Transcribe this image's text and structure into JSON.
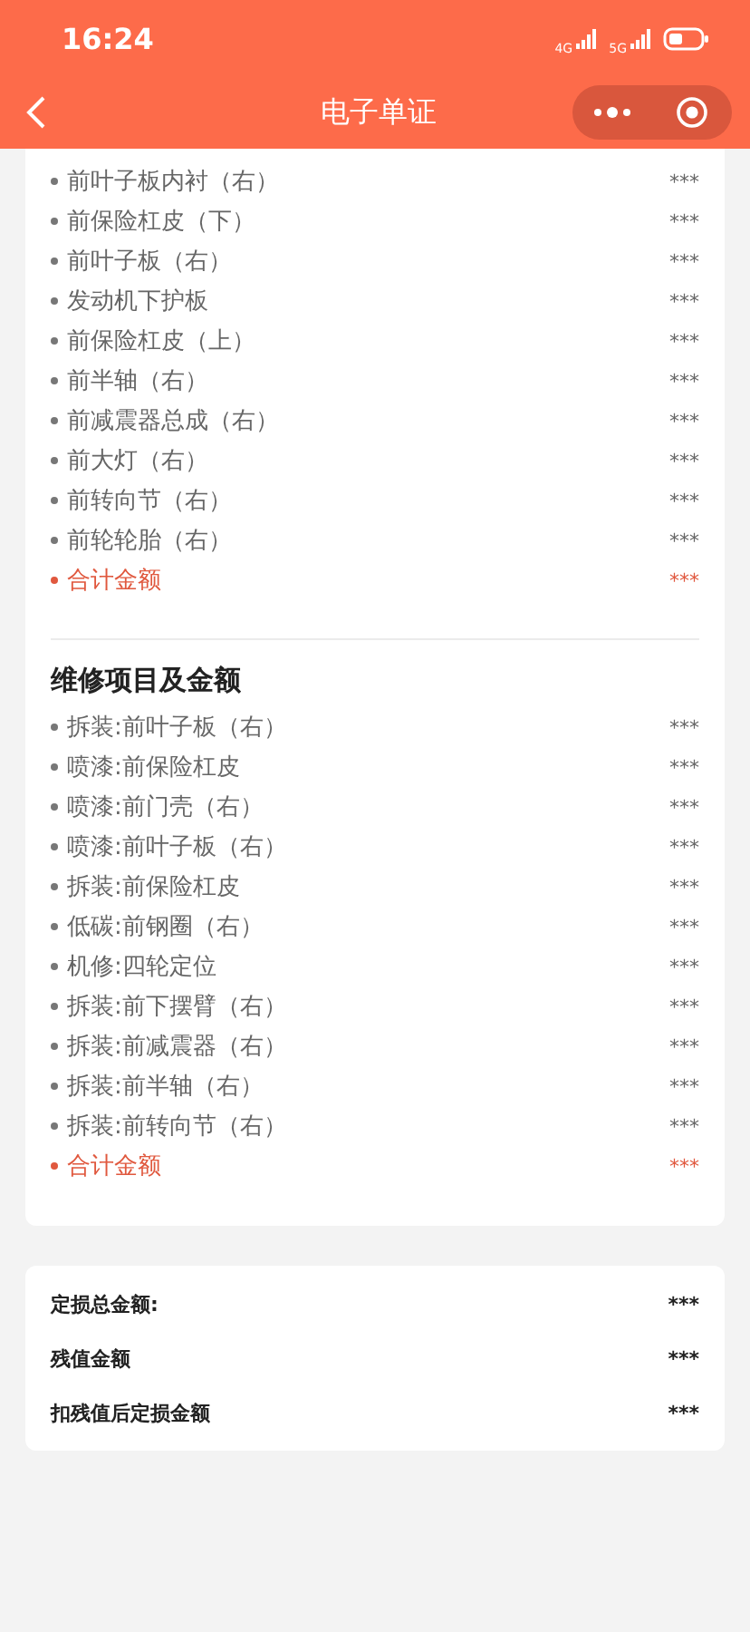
{
  "status_bar": {
    "time": "16:24",
    "network_1": "4G",
    "network_2": "5G"
  },
  "nav_bar": {
    "title": "电子单证"
  },
  "parts_section": {
    "rows": [
      {
        "kind": "item",
        "label": "前叶子板内衬（右）",
        "amount": "***"
      },
      {
        "kind": "item",
        "label": "前保险杠皮（下）",
        "amount": "***"
      },
      {
        "kind": "item",
        "label": "前叶子板（右）",
        "amount": "***"
      },
      {
        "kind": "item",
        "label": "发动机下护板",
        "amount": "***"
      },
      {
        "kind": "item",
        "label": "前保险杠皮（上）",
        "amount": "***"
      },
      {
        "kind": "item",
        "label": "前半轴（右）",
        "amount": "***"
      },
      {
        "kind": "item",
        "label": "前减震器总成（右）",
        "amount": "***"
      },
      {
        "kind": "item",
        "label": "前大灯（右）",
        "amount": "***"
      },
      {
        "kind": "item",
        "label": "前转向节（右）",
        "amount": "***"
      },
      {
        "kind": "item",
        "label": "前轮轮胎（右）",
        "amount": "***"
      },
      {
        "kind": "total",
        "label": "合计金额",
        "amount": "***"
      }
    ]
  },
  "repair_section": {
    "title": "维修项目及金额",
    "rows": [
      {
        "kind": "item",
        "label": "拆装:前叶子板（右）",
        "amount": "***"
      },
      {
        "kind": "item",
        "label": "喷漆:前保险杠皮",
        "amount": "***"
      },
      {
        "kind": "item",
        "label": "喷漆:前门壳（右）",
        "amount": "***"
      },
      {
        "kind": "item",
        "label": "喷漆:前叶子板（右）",
        "amount": "***"
      },
      {
        "kind": "item",
        "label": "拆装:前保险杠皮",
        "amount": "***"
      },
      {
        "kind": "item",
        "label": "低碳:前钢圈（右）",
        "amount": "***"
      },
      {
        "kind": "item",
        "label": "机修:四轮定位",
        "amount": "***"
      },
      {
        "kind": "item",
        "label": "拆装:前下摆臂（右）",
        "amount": "***"
      },
      {
        "kind": "item",
        "label": "拆装:前减震器（右）",
        "amount": "***"
      },
      {
        "kind": "item",
        "label": "拆装:前半轴（右）",
        "amount": "***"
      },
      {
        "kind": "item",
        "label": "拆装:前转向节（右）",
        "amount": "***"
      },
      {
        "kind": "total",
        "label": "合计金额",
        "amount": "***"
      }
    ]
  },
  "summary": [
    {
      "label": "定损总金额:",
      "amount": "***"
    },
    {
      "label": "残值金额",
      "amount": "***"
    },
    {
      "label": "扣残值后定损金额",
      "amount": "***"
    }
  ]
}
